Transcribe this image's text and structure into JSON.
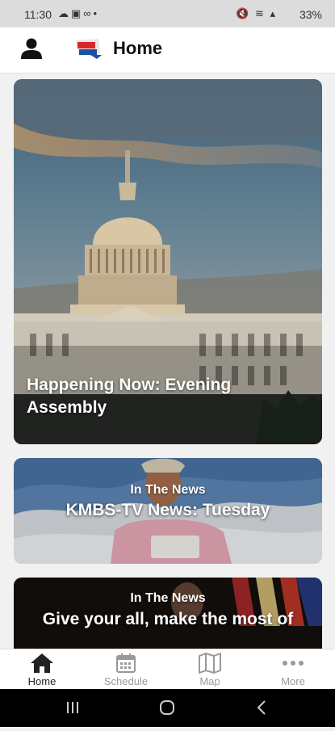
{
  "status_bar": {
    "time": "11:30",
    "battery": "33%"
  },
  "header": {
    "title": "Home"
  },
  "feed": {
    "hero": {
      "title": "Happening Now: Evening Assembly"
    },
    "cards": [
      {
        "kicker": "In The News",
        "title": "KMBS-TV News: Tuesday"
      },
      {
        "kicker": "In The News",
        "title": "Give your all, make the most of"
      }
    ]
  },
  "bottom_nav": [
    {
      "label": "Home",
      "icon": "home-icon",
      "active": true
    },
    {
      "label": "Schedule",
      "icon": "calendar-icon",
      "active": false
    },
    {
      "label": "Map",
      "icon": "map-icon",
      "active": false
    },
    {
      "label": "More",
      "icon": "more-dots-icon",
      "active": false
    }
  ],
  "colors": {
    "accent": "#222222",
    "inactive": "#999999",
    "logo_red": "#d8262a",
    "logo_blue": "#1d4fa3"
  }
}
